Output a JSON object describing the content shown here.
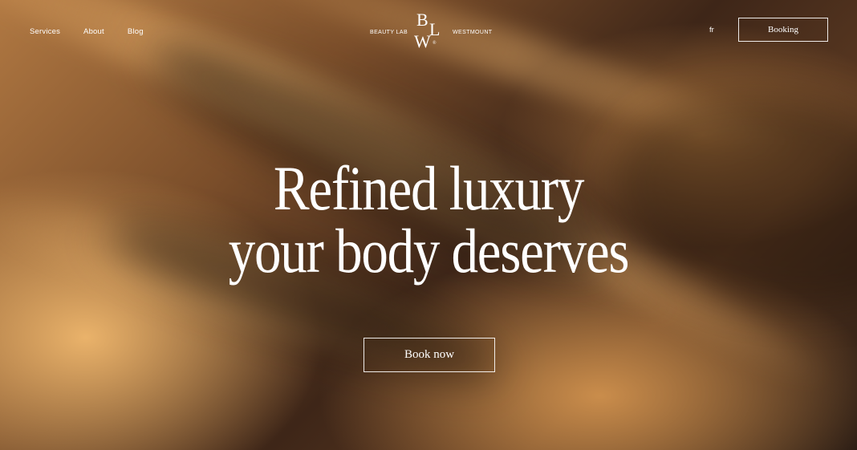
{
  "nav": {
    "items": [
      {
        "label": "Services"
      },
      {
        "label": "About"
      },
      {
        "label": "Blog"
      }
    ]
  },
  "brand": {
    "left_text": "BEAUTY LAB",
    "monogram_b": "B",
    "monogram_l": "L",
    "monogram_w": "W",
    "monogram_mark": "®",
    "right_text": "WESTMOUNT"
  },
  "header": {
    "language": "fr",
    "booking_label": "Booking"
  },
  "hero": {
    "headline_line1": "Refined luxury",
    "headline_line2": "your body deserves",
    "cta_label": "Book now"
  }
}
